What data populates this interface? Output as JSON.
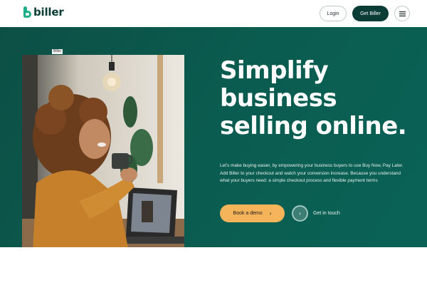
{
  "header": {
    "logo_text": "biller",
    "login_label": "Login",
    "get_label": "Get Biller",
    "menu_icon": "hamburger-menu-icon"
  },
  "hero": {
    "photo_tag": "Biller",
    "headline": [
      "Simplify",
      "business",
      "selling online."
    ],
    "description": "Let's make buying easier, by empowering your business buyers to use Buy Now, Pay Later. Add Biller to your checkout and watch your conversion increase. Because you understand what your buyers need: a simple checkout process and flexible payment terms",
    "demo_label": "Book a demo",
    "demo_chevron": "›",
    "touch_chevron": "›",
    "touch_label": "Get in touch"
  },
  "colors": {
    "brand_dark": "#0b3d36",
    "hero_bg": "#0b5b4f",
    "accent": "#f6b45a"
  }
}
